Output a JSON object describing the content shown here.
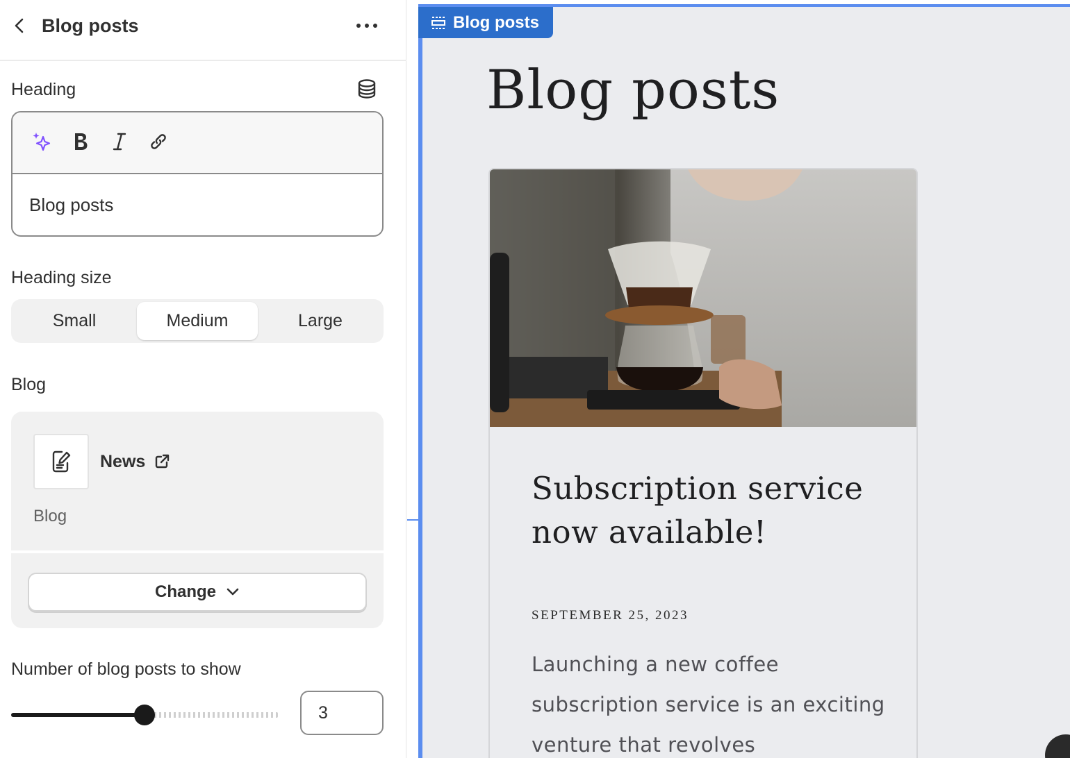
{
  "panel": {
    "title": "Blog posts",
    "back_icon": "chevron-left-icon",
    "more_icon": "ellipsis-horizontal-icon"
  },
  "heading_field": {
    "label": "Heading",
    "source_icon": "database-icon",
    "toolbar": [
      "sparkle-ai-icon",
      "bold-icon",
      "italic-icon",
      "link-icon"
    ],
    "value": "Blog posts"
  },
  "heading_size": {
    "label": "Heading size",
    "options": [
      "Small",
      "Medium",
      "Large"
    ],
    "selected": "Medium"
  },
  "blog_field": {
    "label": "Blog",
    "item_name": "News",
    "item_type": "Blog",
    "item_icon": "document-edit-icon",
    "external_icon": "external-link-icon",
    "change_label": "Change"
  },
  "count_field": {
    "label": "Number of blog posts to show",
    "value": "3",
    "slider_fraction": 0.5
  },
  "preview": {
    "section_tag": "Blog posts",
    "heading": "Blog posts",
    "post": {
      "title": "Subscription service now available!",
      "date": "SEPTEMBER 25, 2023",
      "excerpt": "Launching a new coffee subscription service is an exciting venture that revolves"
    }
  },
  "colors": {
    "accent_blue": "#2c6ecb",
    "section_outline": "#5b8def",
    "ai_purple": "#8051ff"
  }
}
